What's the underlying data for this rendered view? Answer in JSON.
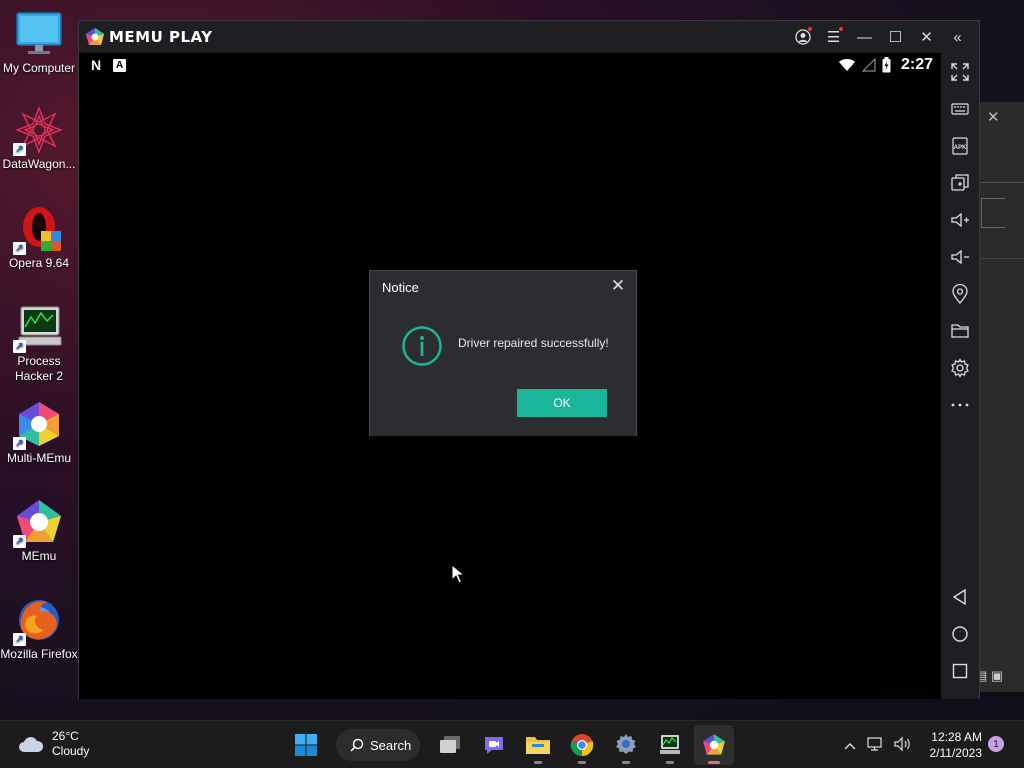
{
  "desktop": {
    "icons": [
      {
        "label": "My Computer",
        "icon": "monitor-icon"
      },
      {
        "label": "DataWagon...",
        "icon": "datawagon-icon"
      },
      {
        "label": "Opera 9.64",
        "icon": "opera-icon"
      },
      {
        "label": "Process Hacker 2",
        "icon": "process-hacker-icon"
      },
      {
        "label": "Multi-MEmu",
        "icon": "multi-memu-icon"
      },
      {
        "label": "MEmu",
        "icon": "memu-icon"
      },
      {
        "label": "Mozilla Firefox",
        "icon": "firefox-icon"
      }
    ]
  },
  "emulator": {
    "title": "MEMU PLAY",
    "status_bar": {
      "left_badges": [
        "N",
        "A"
      ],
      "time": "2:27"
    },
    "sidebar_icons": [
      "fullscreen-icon",
      "keyboard-icon",
      "apk-icon",
      "multi-window-icon",
      "volume-up-icon",
      "volume-down-icon",
      "location-icon",
      "folder-icon",
      "settings-icon",
      "more-icon",
      "back-icon",
      "home-icon",
      "recents-icon"
    ],
    "apk_label": "APK"
  },
  "dialog": {
    "title": "Notice",
    "message": "Driver repaired successfully!",
    "ok_label": "OK"
  },
  "taskbar": {
    "weather_temp": "26°C",
    "weather_desc": "Cloudy",
    "search_label": "Search",
    "time": "12:28 AM",
    "date": "2/11/2023",
    "notification_count": "1"
  },
  "colors": {
    "accent": "#1bb59a",
    "dialog_bg": "#2b2d30",
    "emu_chrome": "#1e1f22"
  }
}
